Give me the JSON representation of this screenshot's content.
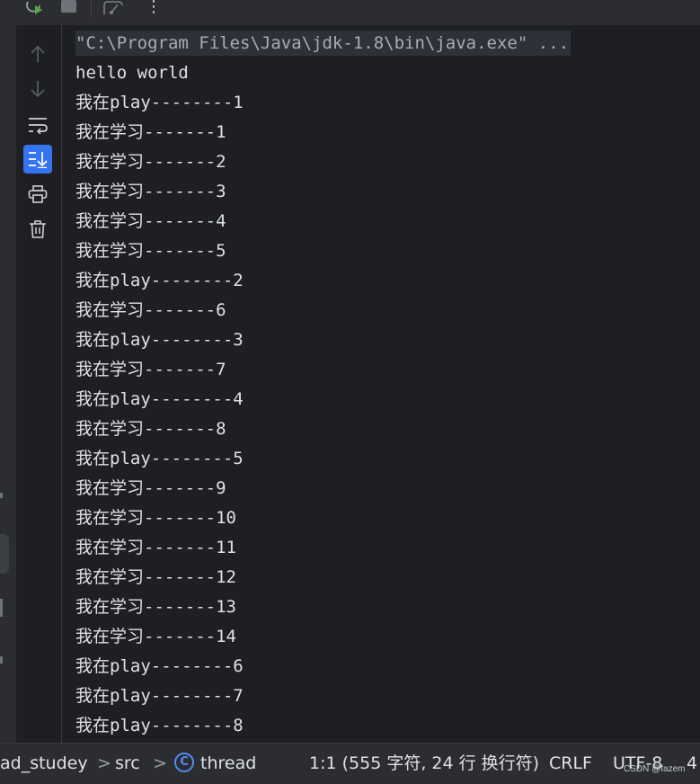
{
  "toolbar": {
    "rerun_icon": "rerun-icon",
    "stop_icon": "stop-icon",
    "screenshot_icon": "camera-icon",
    "more_icon": "more-vertical-icon",
    "more_label": "⋮"
  },
  "gutter": {
    "buttons": [
      {
        "name": "up-arrow-icon"
      },
      {
        "name": "down-arrow-icon"
      },
      {
        "name": "soft-wrap-icon"
      },
      {
        "name": "scroll-to-end-icon",
        "active": true
      },
      {
        "name": "print-icon"
      },
      {
        "name": "trash-icon"
      }
    ]
  },
  "console": {
    "lines": [
      "\"C:\\Program Files\\Java\\jdk-1.8\\bin\\java.exe\" ...",
      "hello world",
      "我在play--------1",
      "我在学习-------1",
      "我在学习-------2",
      "我在学习-------3",
      "我在学习-------4",
      "我在学习-------5",
      "我在play--------2",
      "我在学习-------6",
      "我在play--------3",
      "我在学习-------7",
      "我在play--------4",
      "我在学习-------8",
      "我在play--------5",
      "我在学习-------9",
      "我在学习-------10",
      "我在学习-------11",
      "我在学习-------12",
      "我在学习-------13",
      "我在学习-------14",
      "我在play--------6",
      "我在play--------7",
      "我在play--------8"
    ]
  },
  "status": {
    "project": "ad_studey",
    "chevron": ">",
    "src": "src",
    "thread_icon_letter": "C",
    "thread": "thread",
    "position": "1:1 (555 字符, 24 行 换行符)",
    "line_sep": "CRLF",
    "encoding": "UTF-8",
    "indent": "4"
  },
  "watermark": "CSDN @fazem",
  "colors": {
    "background": "#1e1f22",
    "panel": "#2b2d30",
    "accent": "#3574f0",
    "text": "#dfe1e5"
  }
}
